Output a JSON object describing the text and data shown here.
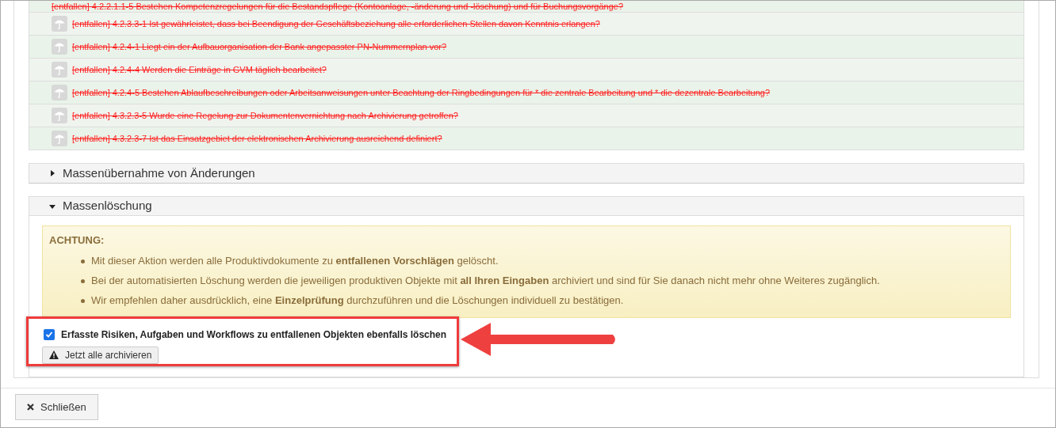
{
  "removed_items": [
    {
      "text": "[entfallen] 4.2.2.1.1-5 Bestehen Kompetenzregelungen für die Bestandspflege (Kontoanlage, -änderung und -löschung) und für Buchungsvorgänge?",
      "struck": true
    },
    {
      "text": "[entfallen] 4.2.3.3-1 Ist gewährleistet, dass bei Beendigung der Geschäftsbeziehung alle erforderlichen Stellen davon Kenntnis erlangen?",
      "struck": true
    },
    {
      "text": "[entfallen] 4.2.4-1 Liegt ein der Aufbauorganisation der Bank angepasster PN-Nummernplan vor?",
      "struck": true
    },
    {
      "text": "[entfallen] 4.2.4-4 Werden die Einträge in GVM täglich bearbeitet?",
      "struck": true
    },
    {
      "text": "[entfallen] 4.2.4-5 Bestehen Ablaufbeschreibungen oder Arbeitsanweisungen unter Beachtung der Ringbedingungen für * die zentrale Bearbeitung und * die dezentrale Bearbeitung?",
      "struck": true
    },
    {
      "text": "[entfallen] 4.3.2.3-5 Wurde eine Regelung zur Dokumentenvernichtung nach Archivierung getroffen?",
      "struck": true
    },
    {
      "text": "[entfallen] 4.3.2.3-7 Ist das Einsatzgebiet der elektronischen Archivierung ausreichend definiert?",
      "struck": true
    }
  ],
  "sections": [
    {
      "title": "Massenübernahme von Änderungen",
      "expanded": false
    },
    {
      "title": "Massenlöschung",
      "expanded": true,
      "alert": {
        "heading": "ACHTUNG:",
        "points": [
          "Mit dieser Aktion werden alle Produktivdokumente zu **entfallenen Vorschlägen** gelöscht.",
          "Bei der automatisierten Löschung werden die jeweiligen produktiven Objekte mit **all Ihren Eingaben** archiviert und sind für Sie danach nicht mehr ohne Weiteres zugänglich.",
          "Wir empfehlen daher ausdrücklich, eine **Einzelprüfung** durchzuführen und die Löschungen individuell zu bestätigen."
        ]
      },
      "checkbox": {
        "label": "Erfasste Risiken, Aufgaben und Workflows zu entfallenen Objekten ebenfalls löschen",
        "checked": true
      },
      "action_button": "Jetzt alle archivieren"
    }
  ],
  "close_button": "Schließen"
}
